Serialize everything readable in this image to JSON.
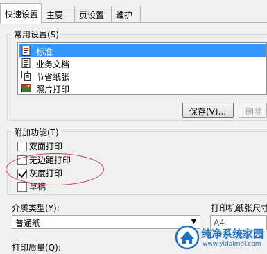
{
  "tabs": [
    {
      "label": "快速设置",
      "active": true
    },
    {
      "label": "主要",
      "active": false
    },
    {
      "label": "页设置",
      "active": false
    },
    {
      "label": "维护",
      "active": false
    }
  ],
  "common_settings": {
    "title": "常用设置(S)",
    "items": [
      {
        "label": "标准",
        "selected": true,
        "icon": "standard-doc-icon"
      },
      {
        "label": "业务文档",
        "selected": false,
        "icon": "business-doc-icon"
      },
      {
        "label": "节省纸张",
        "selected": false,
        "icon": "paper-save-icon"
      },
      {
        "label": "照片打印",
        "selected": false,
        "icon": "photo-print-icon"
      }
    ],
    "save_button": "保存(V)...",
    "delete_button": "删除"
  },
  "additional_features": {
    "title": "附加功能(T)",
    "options": [
      {
        "label": "双面打印",
        "checked": false
      },
      {
        "label": "无边距打印",
        "checked": false
      },
      {
        "label": "灰度打印",
        "checked": true
      },
      {
        "label": "草稿",
        "checked": false
      }
    ]
  },
  "media_type": {
    "label": "介质类型(Y):",
    "value": "普通纸"
  },
  "paper_size": {
    "label": "打印机纸张尺寸",
    "value": "A4"
  },
  "print_quality": {
    "label": "打印质量(Q):"
  },
  "watermark": {
    "title": "纯净系统家园",
    "url": "www.yidaimei.com"
  },
  "colors": {
    "selection": "#3399ff",
    "annotation": "#c43a3a",
    "watermark": "#1f6fc2"
  }
}
